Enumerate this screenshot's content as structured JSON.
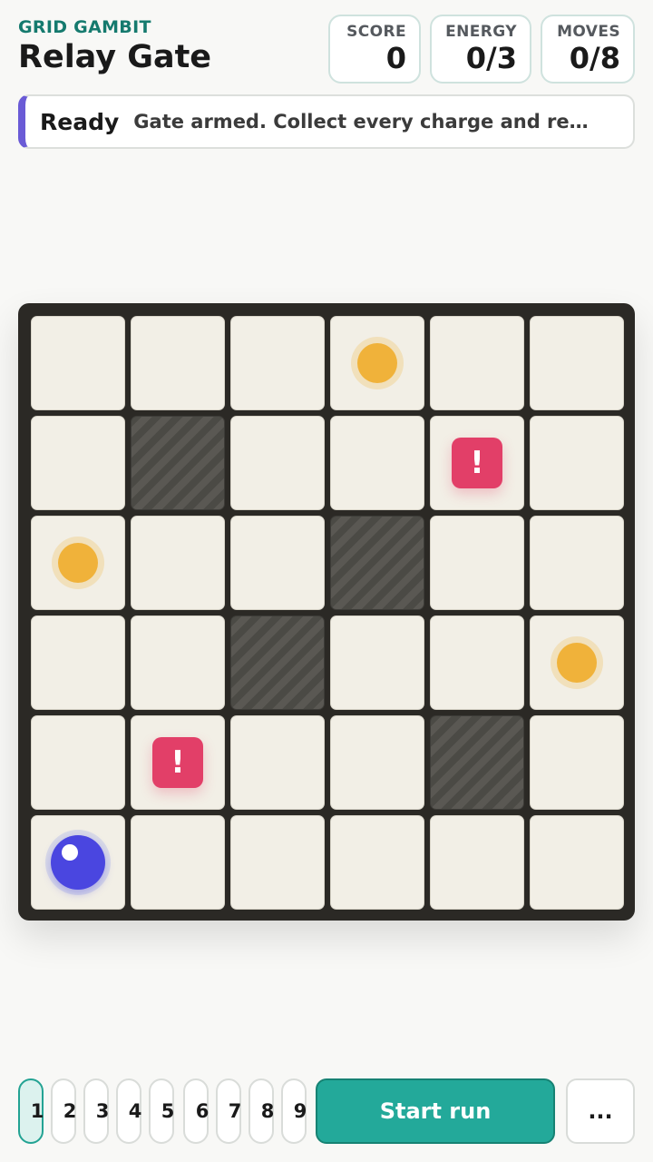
{
  "header": {
    "brand": "GRID GAMBIT",
    "title": "Relay Gate"
  },
  "stats": {
    "score_label": "SCORE",
    "score_value": "0",
    "energy_label": "ENERGY",
    "energy_value": "0/3",
    "moves_label": "MOVES",
    "moves_value": "0/8"
  },
  "status": {
    "label": "Ready",
    "message": "Gate armed. Collect every charge and re…"
  },
  "board": {
    "rows": 6,
    "cols": 6,
    "cells": [
      [
        "empty",
        "empty",
        "empty",
        "charge",
        "empty",
        "empty"
      ],
      [
        "empty",
        "wall",
        "empty",
        "empty",
        "hazard",
        "empty"
      ],
      [
        "charge",
        "empty",
        "empty",
        "wall",
        "empty",
        "empty"
      ],
      [
        "empty",
        "empty",
        "wall",
        "empty",
        "empty",
        "charge"
      ],
      [
        "empty",
        "hazard",
        "empty",
        "empty",
        "wall",
        "empty"
      ],
      [
        "player",
        "empty",
        "empty",
        "empty",
        "empty",
        "empty"
      ]
    ],
    "hazard_glyph": "!"
  },
  "controls": {
    "levels": [
      "1",
      "2",
      "3",
      "4",
      "5",
      "6",
      "7",
      "8",
      "9"
    ],
    "active_level": "1",
    "start_label": "Start run",
    "more_label": "..."
  },
  "colors": {
    "accent": "#23a99a",
    "status_accent": "#6a5bd6",
    "charge": "#f0b23a",
    "hazard": "#e23f68",
    "player": "#4a46e0",
    "board_frame": "#2b2925"
  }
}
